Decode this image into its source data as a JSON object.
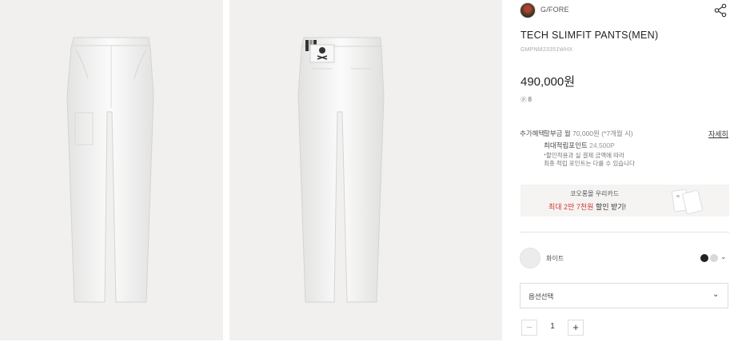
{
  "product": {
    "brand": "G/FORE",
    "title": "TECH SLIMFIT PANTS(MEN)",
    "code": "GMPNM23351WHX",
    "price": "490,000원",
    "point_badge": "8"
  },
  "benefits": {
    "label": "추가혜택",
    "installment_prefix": "할부금 월",
    "installment_amount": "70,000원 (*7개월 시)",
    "points_label": "최대적립포인트",
    "points_value": "24,500P",
    "note": "*할인적용과 실 결제 금액에 따라\n최종 적립 포인트는 다를 수 있습니다",
    "detail_link": "자세히"
  },
  "banner": {
    "line1": "코오롱몰 우리카드",
    "highlight": "최대 2만 7천원",
    "suffix": " 할인 받기!"
  },
  "color": {
    "selected_name": "화이트"
  },
  "option": {
    "placeholder": "옵션선택"
  },
  "quantity": {
    "minus": "−",
    "value": "1",
    "plus": "+"
  },
  "icons": {
    "share": "share-icon",
    "chevron": "chevron-down-icon",
    "point": "point-icon"
  }
}
